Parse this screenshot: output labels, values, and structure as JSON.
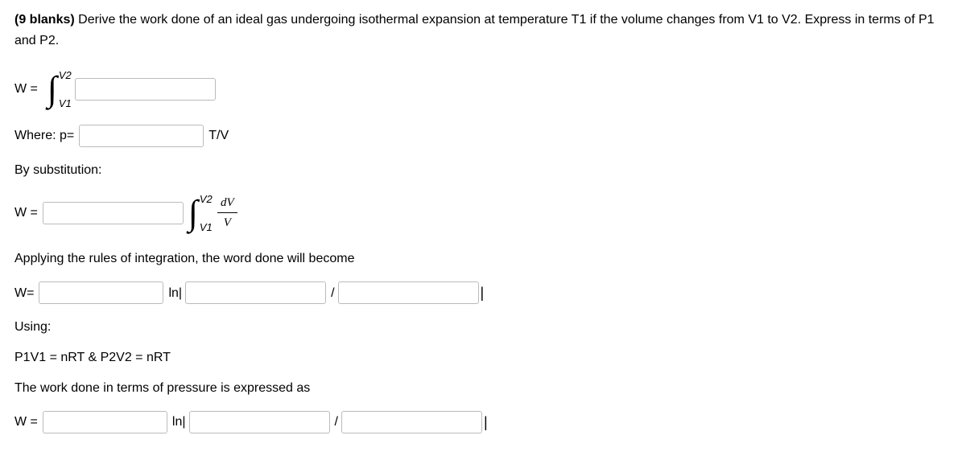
{
  "header": {
    "blanks_label": "(9 blanks)",
    "prompt": "Derive the work done of an ideal gas undergoing isothermal expansion at temperature T1 if the volume changes from V1 to V2. Express in terms of P1 and P2."
  },
  "L1": {
    "lhs": "W =",
    "int_upper": "V2",
    "int_lower": "V1",
    "blank1": ""
  },
  "L2": {
    "where": "Where: p=",
    "blank2": "",
    "suffix": "T/V"
  },
  "L3": {
    "by_sub": "By substitution:"
  },
  "L4": {
    "lhs": "W =",
    "blank3": "",
    "int_upper": "V2",
    "int_lower": "V1",
    "frac_num": "dV",
    "frac_den": "V"
  },
  "L5": {
    "text": "Applying the rules of integration, the word done will become"
  },
  "L6": {
    "lhs": "W=",
    "blank4": "",
    "ln": "ln|",
    "blank5": "",
    "slash": "/",
    "blank6": "",
    "pipe": "|"
  },
  "L7": {
    "using": "Using:",
    "rel": "P1V1 = nRT & P2V2 = nRT",
    "expr": "The work done in terms of pressure is expressed as"
  },
  "L8": {
    "lhs": "W =",
    "blank7": "",
    "ln": "ln|",
    "blank8": "",
    "slash": "/",
    "blank9": "",
    "pipe": "|"
  }
}
